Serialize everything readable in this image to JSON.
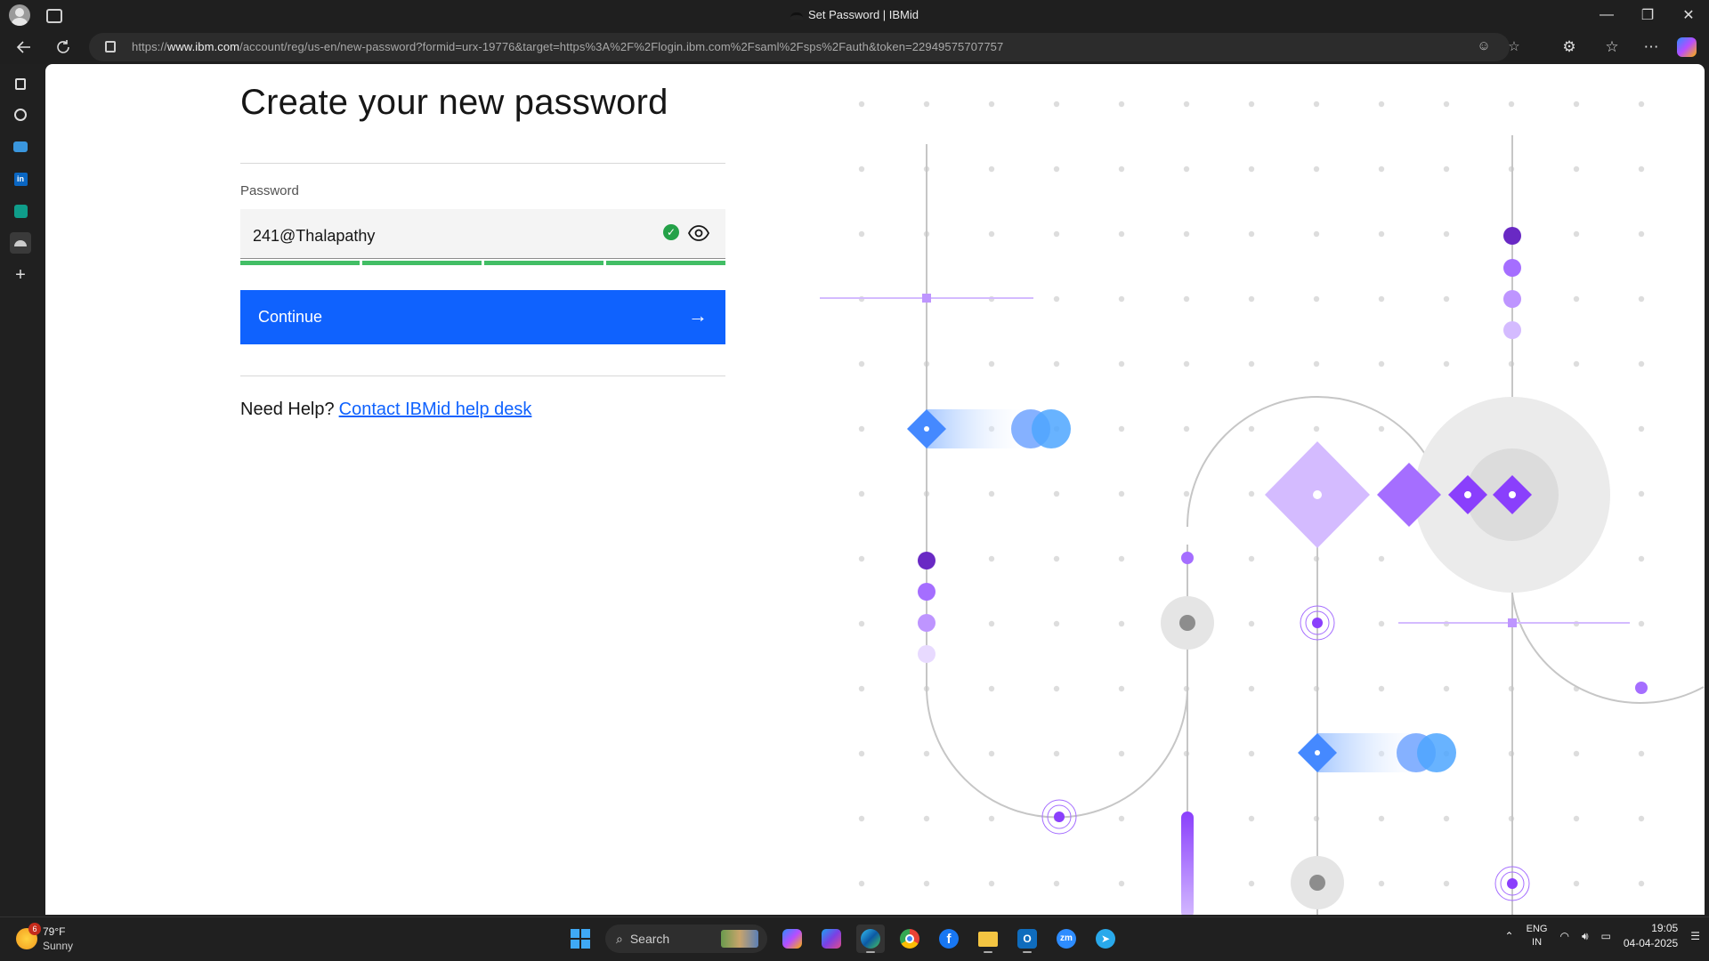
{
  "window": {
    "title": "Set Password | IBMid",
    "controls": [
      "—",
      "❐",
      "✕"
    ]
  },
  "addressbar": {
    "url_prefix": "https://",
    "url_domain": "www.ibm.com",
    "url_path": "/account/reg/us-en/new-password?formid=urx-19776&target=https%3A%2F%2Flogin.ibm.com%2Fsaml%2Fsps%2Fauth&token=22949575707757"
  },
  "page": {
    "heading": "Create your new password",
    "password_label": "Password",
    "password_value": "241@Thalapathy",
    "password_strength_segments": 4,
    "continue_label": "Continue",
    "help_prefix": "Need Help?",
    "help_link": "Contact IBMid help desk"
  },
  "colors": {
    "primary": "#0f62fe",
    "success": "#24a148",
    "strength": "#42be65",
    "purple": "#8a3ffc",
    "light_purple": "#be95ff",
    "blue": "#4589ff"
  },
  "taskbar": {
    "weather_temp": "79°F",
    "weather_desc": "Sunny",
    "weather_badge": "6",
    "search_placeholder": "Search",
    "lang_line1": "ENG",
    "lang_line2": "IN",
    "time": "19:05",
    "date": "04-04-2025"
  }
}
